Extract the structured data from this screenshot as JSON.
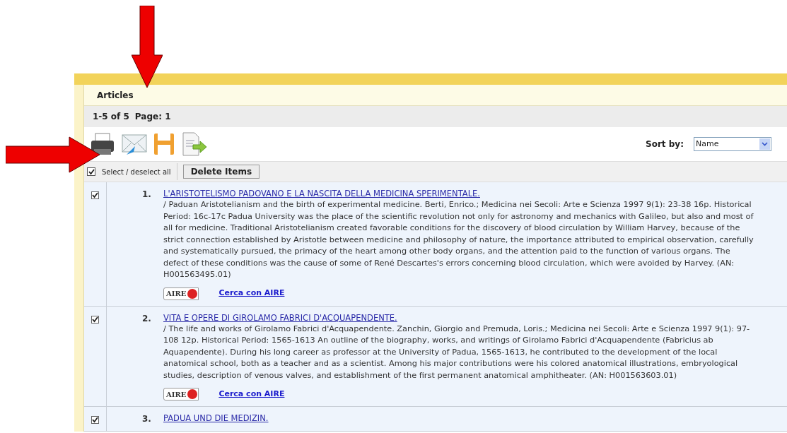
{
  "panel": {
    "title": "Articles",
    "range": "1-5 of 5",
    "page": "Page: 1",
    "sort_label": "Sort by:",
    "sort_value": "Name"
  },
  "toolbar": {
    "select_all": {
      "label": "Select / deselect all",
      "checked": true
    },
    "delete_button": "Delete Items"
  },
  "records": [
    {
      "number": "1.",
      "checked": true,
      "title": "L'ARISTOTELISMO PADOVANO E LA NASCITA DELLA MEDICINA SPERIMENTALE.",
      "abstract": "/ Paduan Aristotelianism and the birth of experimental medicine. Berti, Enrico.; Medicina nei Secoli: Arte e Scienza 1997 9(1): 23-38 16p. Historical Period: 16c-17c Padua University was the place of the scientific revolution not only for astronomy and mechanics with Galileo, but also and most of all for medicine. Traditional Aristotelianism created favorable conditions for the discovery of blood circulation by William Harvey, because of the strict connection established by Aristotle between medicine and philosophy of nature, the importance attributed to empirical observation, carefully and systematically pursued, the primacy of the heart among other body organs, and the attention paid to the function of various organs. The defect of these conditions was the cause of some of René Descartes's errors concerning blood circulation, which were avoided by Harvey. (AN: H001563495.01)",
      "badge": "AIRE",
      "link": "Cerca con AIRE"
    },
    {
      "number": "2.",
      "checked": true,
      "title": "VITA E OPERE DI GIROLAMO FABRICI D'ACQUAPENDENTE.",
      "abstract": "/ The life and works of Girolamo Fabrici d'Acquapendente. Zanchin, Giorgio and Premuda, Loris.; Medicina nei Secoli: Arte e Scienza 1997 9(1): 97-108 12p. Historical Period: 1565-1613 An outline of the biography, works, and writings of Girolamo Fabrici d'Acquapendente (Fabricius ab Aquapendente). During his long career as professor at the University of Padua, 1565-1613, he contributed to the development of the local anatomical school, both as a teacher and as a scientist. Among his major contributions were his colored anatomical illustrations, embryological studies, description of venous valves, and establishment of the first permanent anatomical amphitheater. (AN: H001563603.01)",
      "badge": "AIRE",
      "link": "Cerca con AIRE"
    },
    {
      "number": "3.",
      "checked": true,
      "title": "PADUA UND DIE MEDIZIN."
    }
  ]
}
